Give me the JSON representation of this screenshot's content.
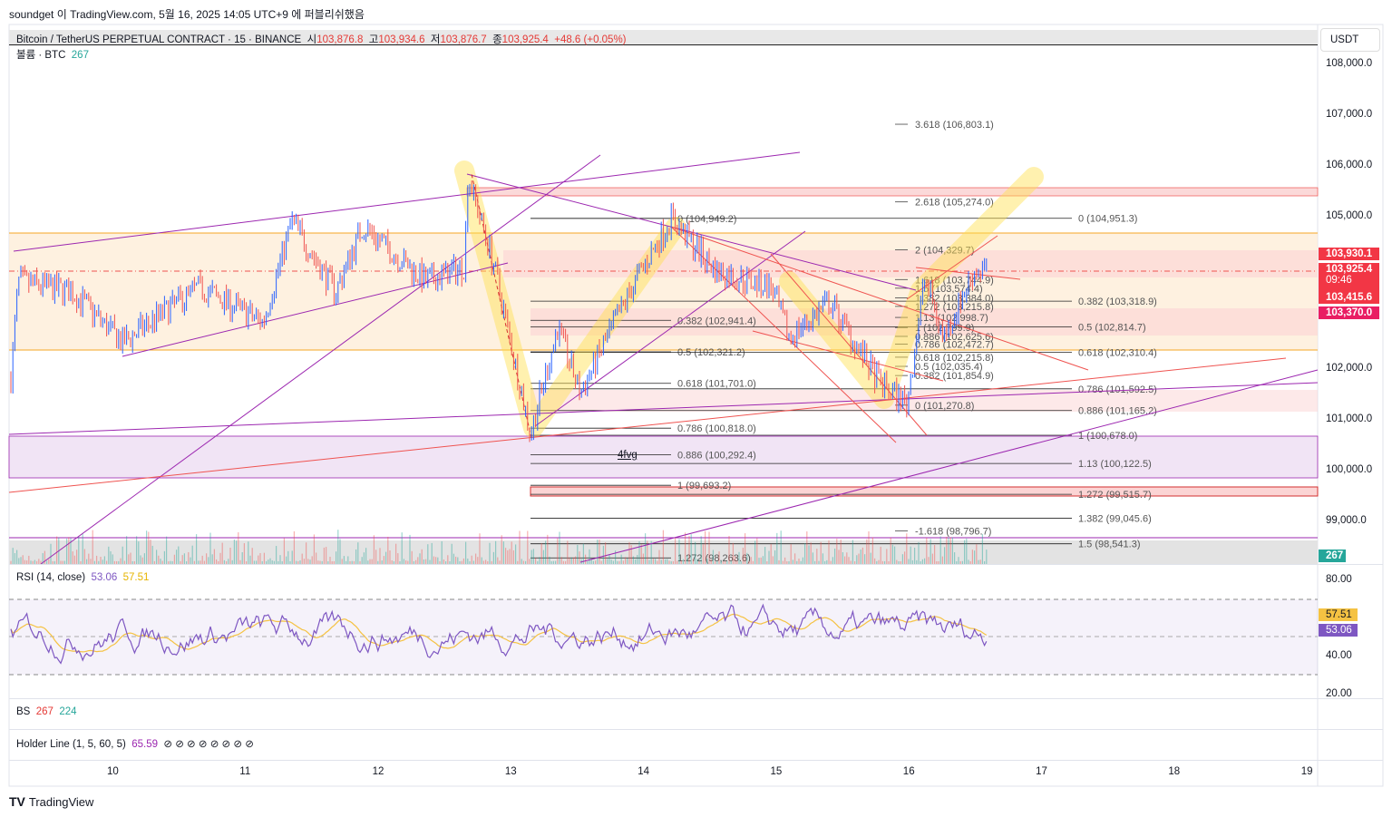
{
  "publish_line": "soundget 이 TradingView.com, 5월 16, 2025 14:05 UTC+9 에 퍼블리쉬했음",
  "symbol": {
    "name": "Bitcoin / TetherUS PERPETUAL CONTRACT · 15 · BINANCE",
    "o_label": "시",
    "open": "103,876.8",
    "h_label": "고",
    "high": "103,934.6",
    "l_label": "저",
    "low": "103,876.7",
    "c_label": "종",
    "close": "103,925.4",
    "change": "+48.6 (+0.05%)"
  },
  "volume": {
    "label": "볼륨 · BTC",
    "value": "267"
  },
  "currency": "USDT",
  "price_axis": [
    "108,000.0",
    "107,000.0",
    "106,000.0",
    "105,000.0",
    "102,000.0",
    "101,000.0",
    "100,000.0",
    "99,000.0"
  ],
  "price_badges": {
    "high": "103,930.1",
    "last": "103,925.4",
    "countdown": "09:46",
    "b3": "103,415.6",
    "b4": "103,370.0",
    "volume": "267"
  },
  "fib_a": [
    "0 (104,949.2)",
    "0.382 (102,941.4)",
    "0.5 (102,321.2)",
    "0.618 (101,701.0)",
    "0.786 (100,818.0)",
    "0.886 (100,292.4)",
    "1 (99,693.2)",
    "1.272 (98,263.6)"
  ],
  "fib_b": [
    "0 (104,951.3)",
    "0.382 (103,318.9)",
    "0.5 (102,814.7)",
    "0.618 (102,310.4)",
    "0.786 (101,592.5)",
    "0.886 (101,165.2)",
    "1 (100,678.0)",
    "1.13 (100,122.5)",
    "1.272 (99,515.7)",
    "1.382 (99,045.6)",
    "1.5 (98,541.3)"
  ],
  "fib_c": [
    "3.618 (106,803.1)",
    "2.618 (105,274.0)",
    "2 (104,329.7)",
    "1.618 (103,744.9)",
    "1.5 (103,574.4)",
    "1.382 (103,384.0)",
    "1.272 (103,215.8)",
    "1.13 (102,998.7)",
    "1 (102,799.9)",
    "0.886 (102,625.6)",
    "0.786 (102,472.7)",
    "0.618 (102,215.8)",
    "0.5 (102,035.4)",
    "0.382 (101,854.9)",
    "0 (101,270.8)",
    "-1.618 (98,796.7)"
  ],
  "annotation": "4fvg",
  "rsi": {
    "label": "RSI (14, close)",
    "value": "53.06",
    "ma": "57.51",
    "axis": [
      "80.00",
      "40.00",
      "20.00"
    ]
  },
  "bs": {
    "label": "BS",
    "v1": "267",
    "v2": "224"
  },
  "holder": {
    "label": "Holder Line (1, 5, 60, 5)",
    "value": "65.59",
    "icons": "⊘ ⊘ ⊘ ⊘ ⊘ ⊘ ⊘ ⊘"
  },
  "time_axis": [
    "10",
    "11",
    "12",
    "13",
    "14",
    "15",
    "16",
    "17",
    "18",
    "19"
  ],
  "colors": {
    "up": "#26a69a",
    "down": "#ef5350",
    "rsi": "#7e57c2",
    "rsi_ma": "#f5c242",
    "badge": "#f23645"
  },
  "brand": "TradingView"
}
